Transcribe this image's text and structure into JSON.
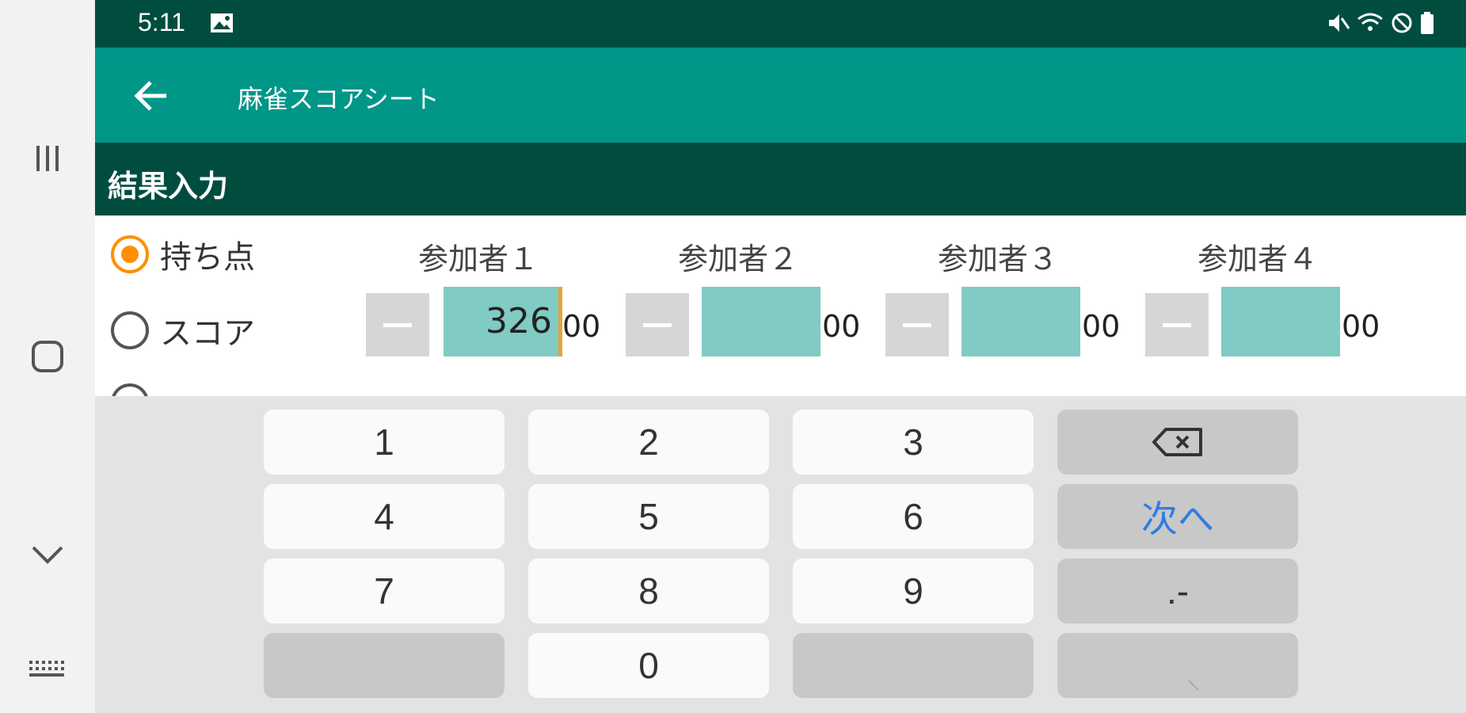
{
  "status": {
    "time": "5:11"
  },
  "appbar": {
    "title": "麻雀スコアシート"
  },
  "section": {
    "title": "結果入力"
  },
  "modes": [
    {
      "label": "持ち点",
      "checked": true
    },
    {
      "label": "スコア",
      "checked": false
    }
  ],
  "players": [
    {
      "label": "参加者１",
      "value": "326",
      "suffix": "00"
    },
    {
      "label": "参加者２",
      "value": "",
      "suffix": "00"
    },
    {
      "label": "参加者３",
      "value": "",
      "suffix": "00"
    },
    {
      "label": "参加者４",
      "value": "",
      "suffix": "00"
    }
  ],
  "keyboard": {
    "k1": "1",
    "k2": "2",
    "k3": "3",
    "k4": "4",
    "k5": "5",
    "k6": "6",
    "k7": "7",
    "k8": "8",
    "k9": "9",
    "k0": "0",
    "next": "次へ",
    "dotminus": ".-"
  },
  "colors": {
    "statusbar": "#004d40",
    "appbar": "#009688",
    "accent": "#ff8f00",
    "field": "#80cbc4",
    "next_key": "#2f7de1"
  }
}
